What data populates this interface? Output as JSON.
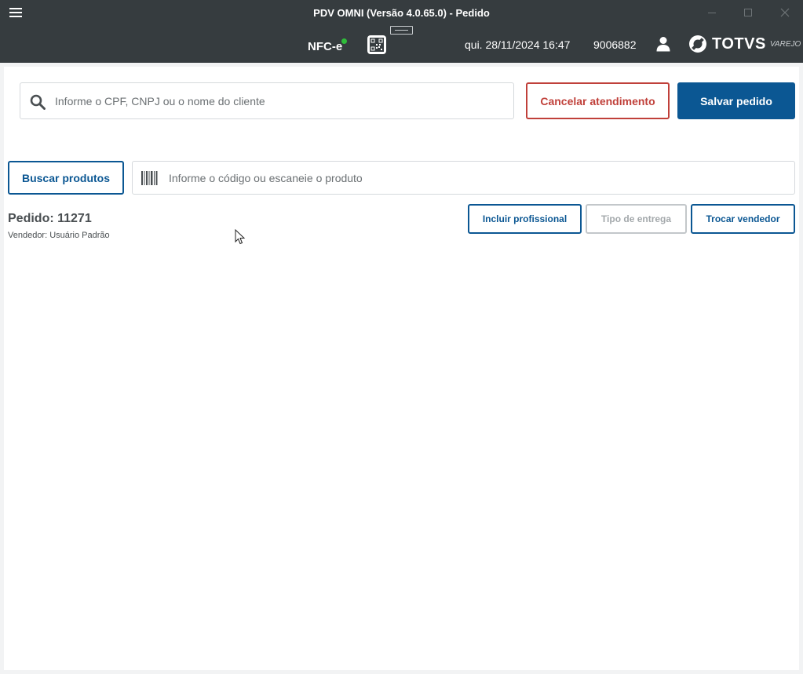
{
  "window": {
    "title": "PDV OMNI (Versão 4.0.65.0) - Pedido"
  },
  "header": {
    "fiscal_mode": "NFC-e",
    "datetime": "qui. 28/11/2024 16:47",
    "store_code": "9006882",
    "brand": "TOTVS",
    "brand_sub": "VAREJO"
  },
  "customer": {
    "search_placeholder": "Informe o CPF, CNPJ ou o nome do cliente",
    "search_value": "",
    "cancel_label": "Cancelar atendimento",
    "save_label": "Salvar pedido"
  },
  "products": {
    "search_button_label": "Buscar produtos",
    "code_placeholder": "Informe o código ou escaneie o produto",
    "code_value": ""
  },
  "order": {
    "title": "Pedido: 11271",
    "seller": "Vendedor: Usuário Padrão",
    "actions": {
      "include_professional": "Incluir profissional",
      "delivery_type": "Tipo de entrega",
      "change_seller": "Trocar vendedor"
    }
  },
  "colors": {
    "titlebar": "#363c3f",
    "primary": "#0b5793",
    "danger": "#c0403a",
    "disabled": "#a3a8ab",
    "status_online": "#2fbd3a"
  },
  "icons": {
    "menu": "hamburger-icon",
    "qr": "qr-code-icon",
    "user": "user-icon",
    "search": "search-icon",
    "barcode": "barcode-icon"
  }
}
